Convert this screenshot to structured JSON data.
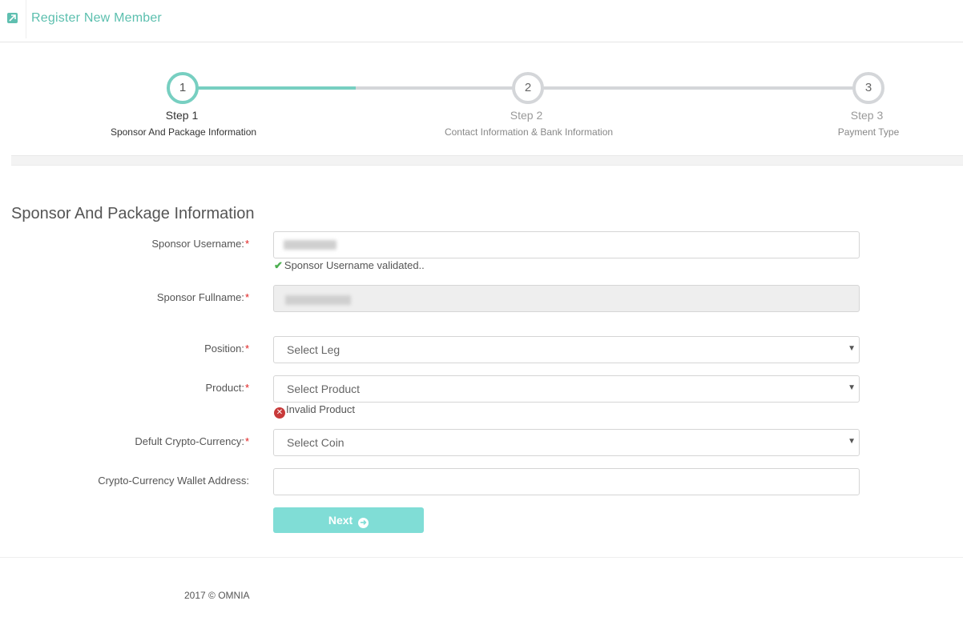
{
  "header": {
    "title": "Register New Member",
    "icon": "external-link-icon"
  },
  "wizard": {
    "steps": [
      {
        "number": "1",
        "title": "Step 1",
        "subtitle": "Sponsor And Package Information"
      },
      {
        "number": "2",
        "title": "Step 2",
        "subtitle": "Contact Information & Bank Information"
      },
      {
        "number": "3",
        "title": "Step 3",
        "subtitle": "Payment Type"
      }
    ]
  },
  "form": {
    "section_title": "Sponsor And Package Information",
    "sponsor_username_label": "Sponsor Username:",
    "sponsor_username_msg": "Sponsor Username validated..",
    "sponsor_fullname_label": "Sponsor Fullname:",
    "position_label": "Position:",
    "position_value": "Select Leg",
    "product_label": "Product:",
    "product_value": "Select Product",
    "product_error": "Invalid Product",
    "coin_label": "Defult Crypto-Currency:",
    "coin_value": "Select Coin",
    "wallet_label": "Crypto-Currency Wallet Address:",
    "wallet_value": "",
    "required_mark": "*",
    "next_label": "Next"
  },
  "footer": {
    "text": "2017 © OMNIA"
  },
  "colors": {
    "accent": "#77cfc1",
    "button": "#80ddd6",
    "required": "#e02020"
  }
}
